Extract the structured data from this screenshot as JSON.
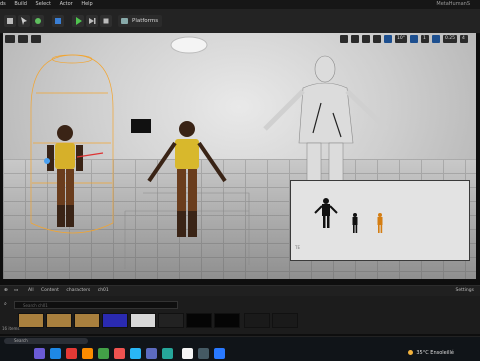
{
  "menu": {
    "items": [
      "ds",
      "Build",
      "Select",
      "Actor",
      "Help"
    ],
    "project": "MetaHumanS"
  },
  "toolbar": {
    "platforms_label": "Platforms"
  },
  "viewport": {
    "right_buttons": [
      "10°",
      "1",
      "0.25",
      "4"
    ],
    "inset_caption": "",
    "inset_sub": "",
    "inset_tag": "TE"
  },
  "content_browser": {
    "breadcrumb": [
      "All",
      "Content",
      "characters",
      "ch01"
    ],
    "settings_label": "Settings",
    "search_placeholder": "Search ch01",
    "item_count": "16 items"
  },
  "taskbar": {
    "search_placeholder": "Search",
    "weather": "35°C  Ensoleillé"
  },
  "colors": {
    "accent_blue": "#1d4f8f",
    "selection_orange": "#f2a531"
  }
}
